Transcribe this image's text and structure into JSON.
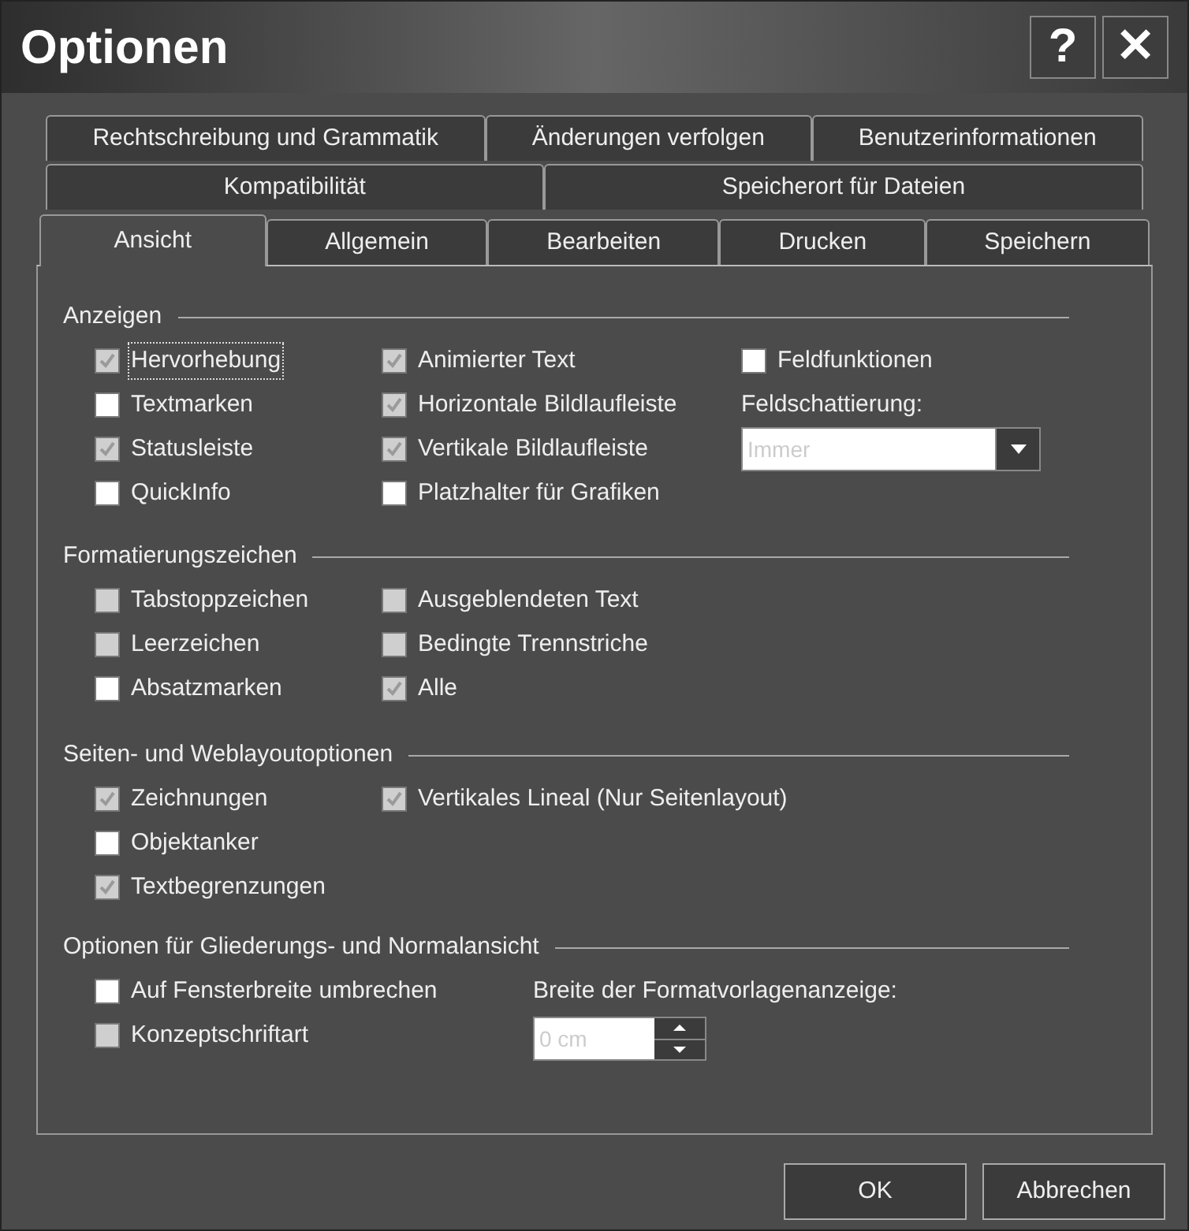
{
  "window": {
    "title": "Optionen",
    "controls": [
      "?",
      "✕"
    ]
  },
  "tab_rows": [
    [
      {
        "label": "Rechtschreibung und Grammatik",
        "selected": false
      },
      {
        "label": "Änderungen verfolgen",
        "selected": false
      },
      {
        "label": "Benutzerinformationen",
        "selected": false
      }
    ],
    [
      {
        "label": "Kompatibilität",
        "selected": false
      },
      {
        "label": "Speicherort für Dateien",
        "selected": false
      }
    ],
    [
      {
        "label": "Ansicht",
        "selected": true
      },
      {
        "label": "Allgemein",
        "selected": false
      },
      {
        "label": "Bearbeiten",
        "selected": false
      },
      {
        "label": "Drucken",
        "selected": false
      },
      {
        "label": "Speichern",
        "selected": false
      }
    ]
  ],
  "sections": [
    {
      "title": "Anzeigen",
      "columns": [
        [
          {
            "kind": "checkbox",
            "label": "Hervorhebung",
            "checked": true,
            "disabled": true,
            "focused": true
          },
          {
            "kind": "checkbox",
            "label": "Textmarken",
            "checked": false,
            "disabled": false,
            "focused": false
          },
          {
            "kind": "checkbox",
            "label": "Statusleiste",
            "checked": true,
            "disabled": true,
            "focused": false
          },
          {
            "kind": "checkbox",
            "label": "QuickInfo",
            "checked": false,
            "disabled": false,
            "focused": false
          }
        ],
        [
          {
            "kind": "checkbox",
            "label": "Animierter Text",
            "checked": true,
            "disabled": true,
            "focused": false
          },
          {
            "kind": "checkbox",
            "label": "Horizontale Bildlaufleiste",
            "checked": true,
            "disabled": true,
            "focused": false
          },
          {
            "kind": "checkbox",
            "label": "Vertikale Bildlaufleiste",
            "checked": true,
            "disabled": true,
            "focused": false
          },
          {
            "kind": "checkbox",
            "label": "Platzhalter für Grafiken",
            "checked": false,
            "disabled": false,
            "focused": false
          }
        ],
        [
          {
            "kind": "checkbox",
            "label": "Feldfunktionen",
            "checked": false,
            "disabled": false,
            "focused": false
          },
          {
            "kind": "label",
            "label": "Feldschattierung:"
          },
          {
            "kind": "select",
            "value": "Immer",
            "disabled": true
          }
        ]
      ]
    },
    {
      "title": "Formatierungszeichen",
      "columns": [
        [
          {
            "kind": "checkbox",
            "label": "Tabstoppzeichen",
            "checked": false,
            "disabled": true,
            "focused": false
          },
          {
            "kind": "checkbox",
            "label": "Leerzeichen",
            "checked": false,
            "disabled": true,
            "focused": false
          },
          {
            "kind": "checkbox",
            "label": "Absatzmarken",
            "checked": false,
            "disabled": false,
            "focused": false
          }
        ],
        [
          {
            "kind": "checkbox",
            "label": "Ausgeblendeten Text",
            "checked": false,
            "disabled": true,
            "focused": false
          },
          {
            "kind": "checkbox",
            "label": "Bedingte Trennstriche",
            "checked": false,
            "disabled": true,
            "focused": false
          },
          {
            "kind": "checkbox",
            "label": "Alle",
            "checked": true,
            "disabled": true,
            "focused": false
          }
        ]
      ]
    },
    {
      "title": "Seiten- und Weblayoutoptionen",
      "columns": [
        [
          {
            "kind": "checkbox",
            "label": "Zeichnungen",
            "checked": true,
            "disabled": true,
            "focused": false
          },
          {
            "kind": "checkbox",
            "label": "Objektanker",
            "checked": false,
            "disabled": false,
            "focused": false
          },
          {
            "kind": "checkbox",
            "label": "Textbegrenzungen",
            "checked": true,
            "disabled": true,
            "focused": false
          }
        ],
        [
          {
            "kind": "checkbox",
            "label": "Vertikales Lineal (Nur Seitenlayout)",
            "checked": true,
            "disabled": true,
            "focused": false
          }
        ]
      ]
    },
    {
      "title": "Optionen für Gliederungs- und Normalansicht",
      "columns": [
        [
          {
            "kind": "checkbox",
            "label": "Auf Fensterbreite umbrechen",
            "checked": false,
            "disabled": false,
            "focused": false
          },
          {
            "kind": "checkbox",
            "label": "Konzeptschriftart",
            "checked": false,
            "disabled": true,
            "focused": false
          }
        ],
        [
          {
            "kind": "label",
            "label": "Breite der Formatvorlagenanzeige:"
          },
          {
            "kind": "spinner",
            "value": "0 cm",
            "disabled": true
          }
        ]
      ]
    }
  ],
  "buttons": [
    "OK",
    "Abbrechen"
  ]
}
